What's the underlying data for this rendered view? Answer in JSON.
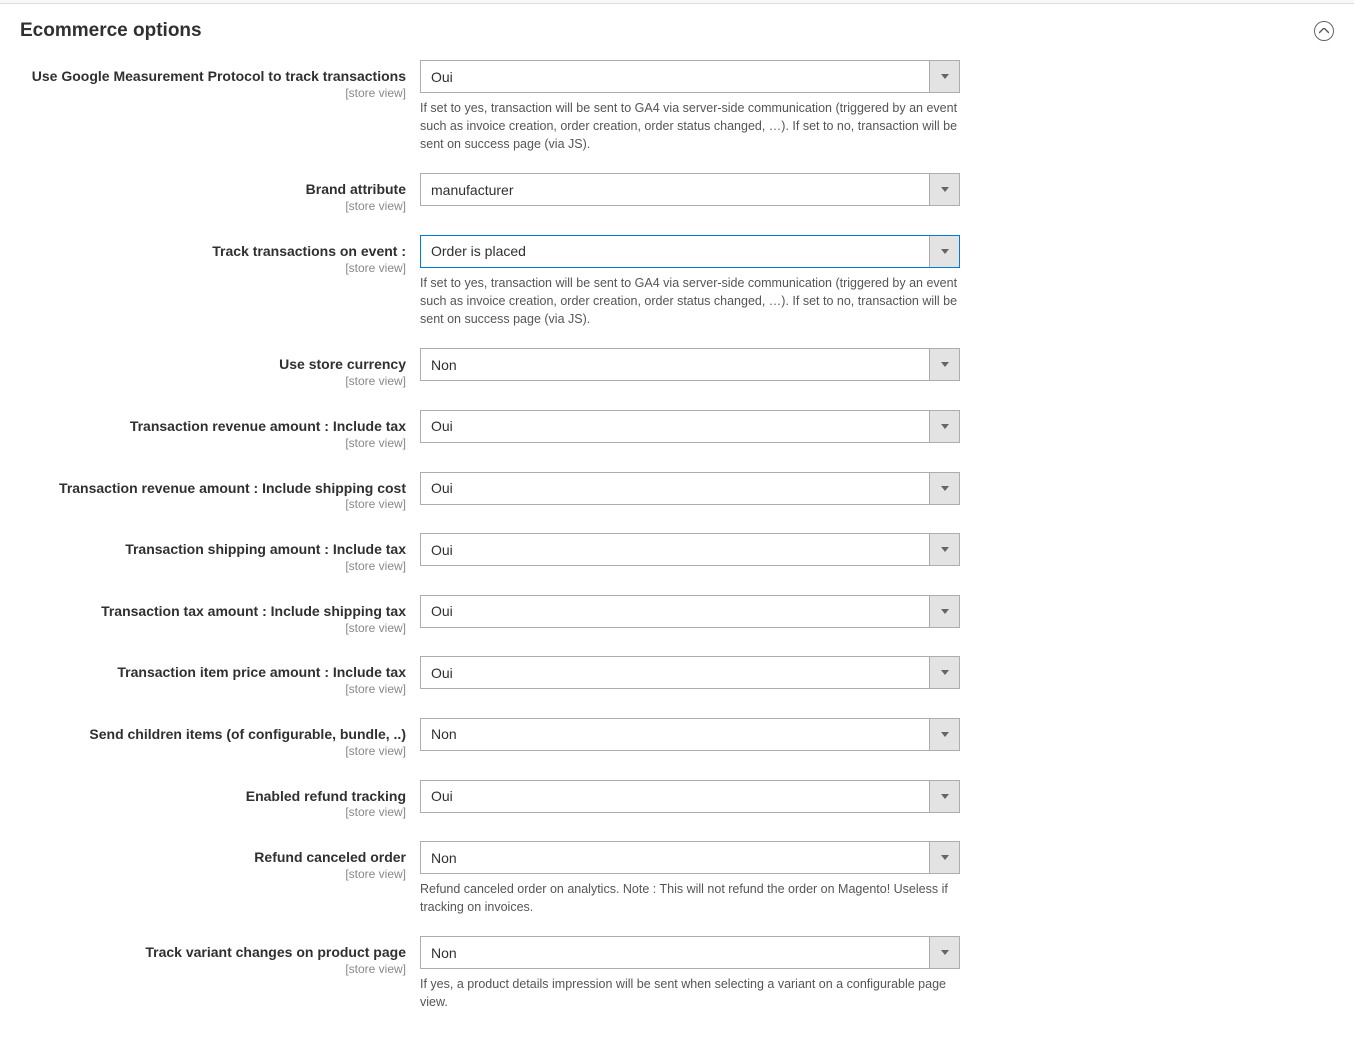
{
  "section": {
    "title": "Ecommerce options"
  },
  "scope": "[store view]",
  "fields": {
    "useMeasurement": {
      "label": "Use Google Measurement Protocol to track transactions",
      "value": "Oui",
      "comment": "If set to yes, transaction will be sent to GA4 via server-side communication (triggered by an event such as invoice creation, order creation, order status changed, …). If set to no, transaction will be sent on success page (via JS)."
    },
    "brandAttribute": {
      "label": "Brand attribute",
      "value": "manufacturer"
    },
    "trackEvent": {
      "label": "Track transactions on event :",
      "value": "Order is placed",
      "comment": "If set to yes, transaction will be sent to GA4 via server-side communication (triggered by an event such as invoice creation, order creation, order status changed, …). If set to no, transaction will be sent on success page (via JS)."
    },
    "useStoreCurrency": {
      "label": "Use store currency",
      "value": "Non"
    },
    "revenueIncludeTax": {
      "label": "Transaction revenue amount : Include tax",
      "value": "Oui"
    },
    "revenueIncludeShipping": {
      "label": "Transaction revenue amount : Include shipping cost",
      "value": "Oui"
    },
    "shippingIncludeTax": {
      "label": "Transaction shipping amount : Include tax",
      "value": "Oui"
    },
    "taxIncludeShippingTax": {
      "label": "Transaction tax amount : Include shipping tax",
      "value": "Oui"
    },
    "itemPriceIncludeTax": {
      "label": "Transaction item price amount : Include tax",
      "value": "Oui"
    },
    "sendChildren": {
      "label": "Send children items (of configurable, bundle, ..)",
      "value": "Non"
    },
    "refundTracking": {
      "label": "Enabled refund tracking",
      "value": "Oui"
    },
    "refundCanceled": {
      "label": "Refund canceled order",
      "value": "Non",
      "comment": "Refund canceled order on analytics. Note : This will not refund the order on Magento! Useless if tracking on invoices."
    },
    "trackVariant": {
      "label": "Track variant changes on product page",
      "value": "Non",
      "comment": "If yes, a product details impression will be sent when selecting a variant on a configurable page view."
    }
  }
}
